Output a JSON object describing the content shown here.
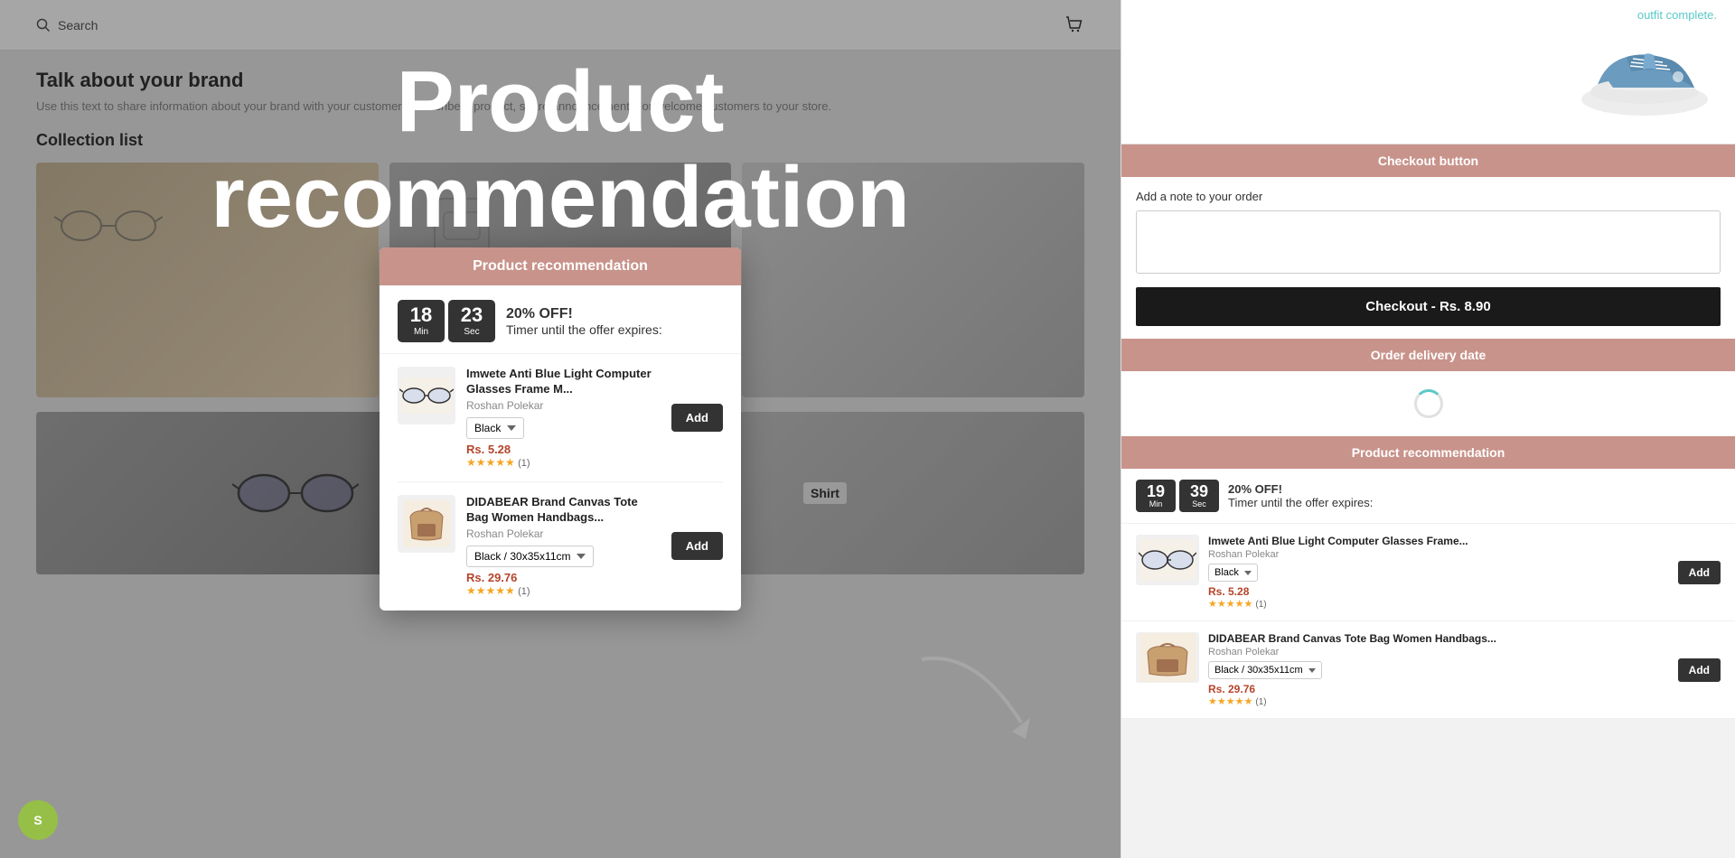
{
  "header": {
    "search_placeholder": "Search",
    "cart_icon": "cart-icon",
    "search_icon": "search-icon"
  },
  "overlay": {
    "line1": "Product",
    "line2": "recommendation"
  },
  "page": {
    "brand_title": "Talk about your brand",
    "brand_desc": "Use this text to share information about your brand with your customers. Describe a product, share announcements, or welcome customers to your store.",
    "collection_title": "Collection list",
    "collection_label": "Shirt"
  },
  "modal": {
    "title": "Product recommendation",
    "timer": {
      "minutes": "18",
      "seconds": "23",
      "min_label": "Min",
      "sec_label": "Sec",
      "offer_text": "20% OFF!",
      "expires_text": "Timer until the offer expires:"
    },
    "products": [
      {
        "name": "Imwete Anti Blue Light Computer Glasses Frame M...",
        "vendor": "Roshan Polekar",
        "variant": "Black",
        "price": "Rs. 5.28",
        "rating": "★★★★★",
        "reviews": "(1)",
        "add_label": "Add"
      },
      {
        "name": "DIDABEAR Brand Canvas Tote Bag Women Handbags...",
        "vendor": "Roshan Polekar",
        "variant": "Black / 30x35x11cm",
        "price": "Rs. 29.76",
        "rating": "★★★★★",
        "reviews": "(1)",
        "add_label": "Add"
      }
    ]
  },
  "sidebar": {
    "outfit_complete": "outfit complete.",
    "checkout_section": {
      "title": "Checkout button",
      "note_label": "Add a note to your order",
      "note_placeholder": "",
      "checkout_btn_label": "Checkout - Rs. 8.90"
    },
    "delivery_section": {
      "title": "Order delivery date"
    },
    "product_rec_section": {
      "title": "Product recommendation",
      "timer": {
        "minutes": "19",
        "seconds": "39",
        "min_label": "Min",
        "sec_label": "Sec",
        "offer_text": "20% OFF!",
        "expires_text": "Timer until the offer expires:"
      },
      "products": [
        {
          "name": "Imwete Anti Blue Light Computer Glasses Frame...",
          "vendor": "Roshan Polekar",
          "variant": "Black",
          "price": "Rs. 5.28",
          "rating": "★★★★★",
          "reviews": "(1)",
          "add_label": "Add"
        },
        {
          "name": "DIDABEAR Brand Canvas Tote Bag Women Handbags...",
          "vendor": "Roshan Polekar",
          "variant": "Black / 30x35x11cm",
          "price": "Rs. 29.76",
          "rating": "★★★★★",
          "reviews": "(1)",
          "add_label": "Add"
        }
      ]
    }
  },
  "shopify_badge": "S"
}
